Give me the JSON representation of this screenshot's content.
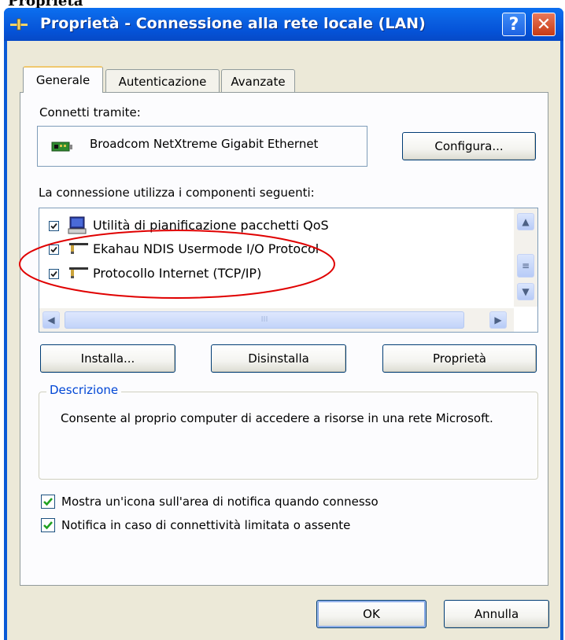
{
  "doc_fragment": "Proprietà",
  "window": {
    "title": "Proprietà - Connessione alla rete locale (LAN)",
    "help_button": "?",
    "close_button": "✕"
  },
  "tabs": [
    {
      "label": "Generale",
      "active": true
    },
    {
      "label": "Autenticazione",
      "active": false
    },
    {
      "label": "Avanzate",
      "active": false
    }
  ],
  "connect_using": {
    "label": "Connetti tramite:",
    "device_name": "Broadcom NetXtreme Gigabit Ethernet",
    "configure_button": "Configura..."
  },
  "components": {
    "label": "La connessione utilizza i componenti seguenti:",
    "items": [
      {
        "label": "Utilità di pianificazione pacchetti QoS",
        "checked": true,
        "icon": "qos-computer-icon"
      },
      {
        "label": "Ekahau NDIS Usermode I/O Protocol",
        "checked": true,
        "icon": "network-protocol-icon"
      },
      {
        "label": "Protocollo Internet (TCP/IP)",
        "checked": true,
        "icon": "network-protocol-icon"
      }
    ],
    "scroll_thumb_grip": "III"
  },
  "actions": {
    "install": "Installa...",
    "uninstall": "Disinstalla",
    "properties": "Proprietà"
  },
  "description": {
    "legend": "Descrizione",
    "text": "Consente al proprio computer di accedere a risorse in una rete Microsoft."
  },
  "options": {
    "show_icon": {
      "label": "Mostra un'icona sull'area di notifica quando connesso",
      "checked": true
    },
    "notify_limited": {
      "label": "Notifica in caso di connettività limitata o assente",
      "checked": true
    }
  },
  "footer": {
    "ok": "OK",
    "cancel": "Annulla"
  },
  "colors": {
    "titlebar": "#0a5fe0",
    "dialog_face": "#ece9d8",
    "annotation_ellipse": "#e00000",
    "group_legend": "#0046d5",
    "checkmark": "#21a121"
  }
}
